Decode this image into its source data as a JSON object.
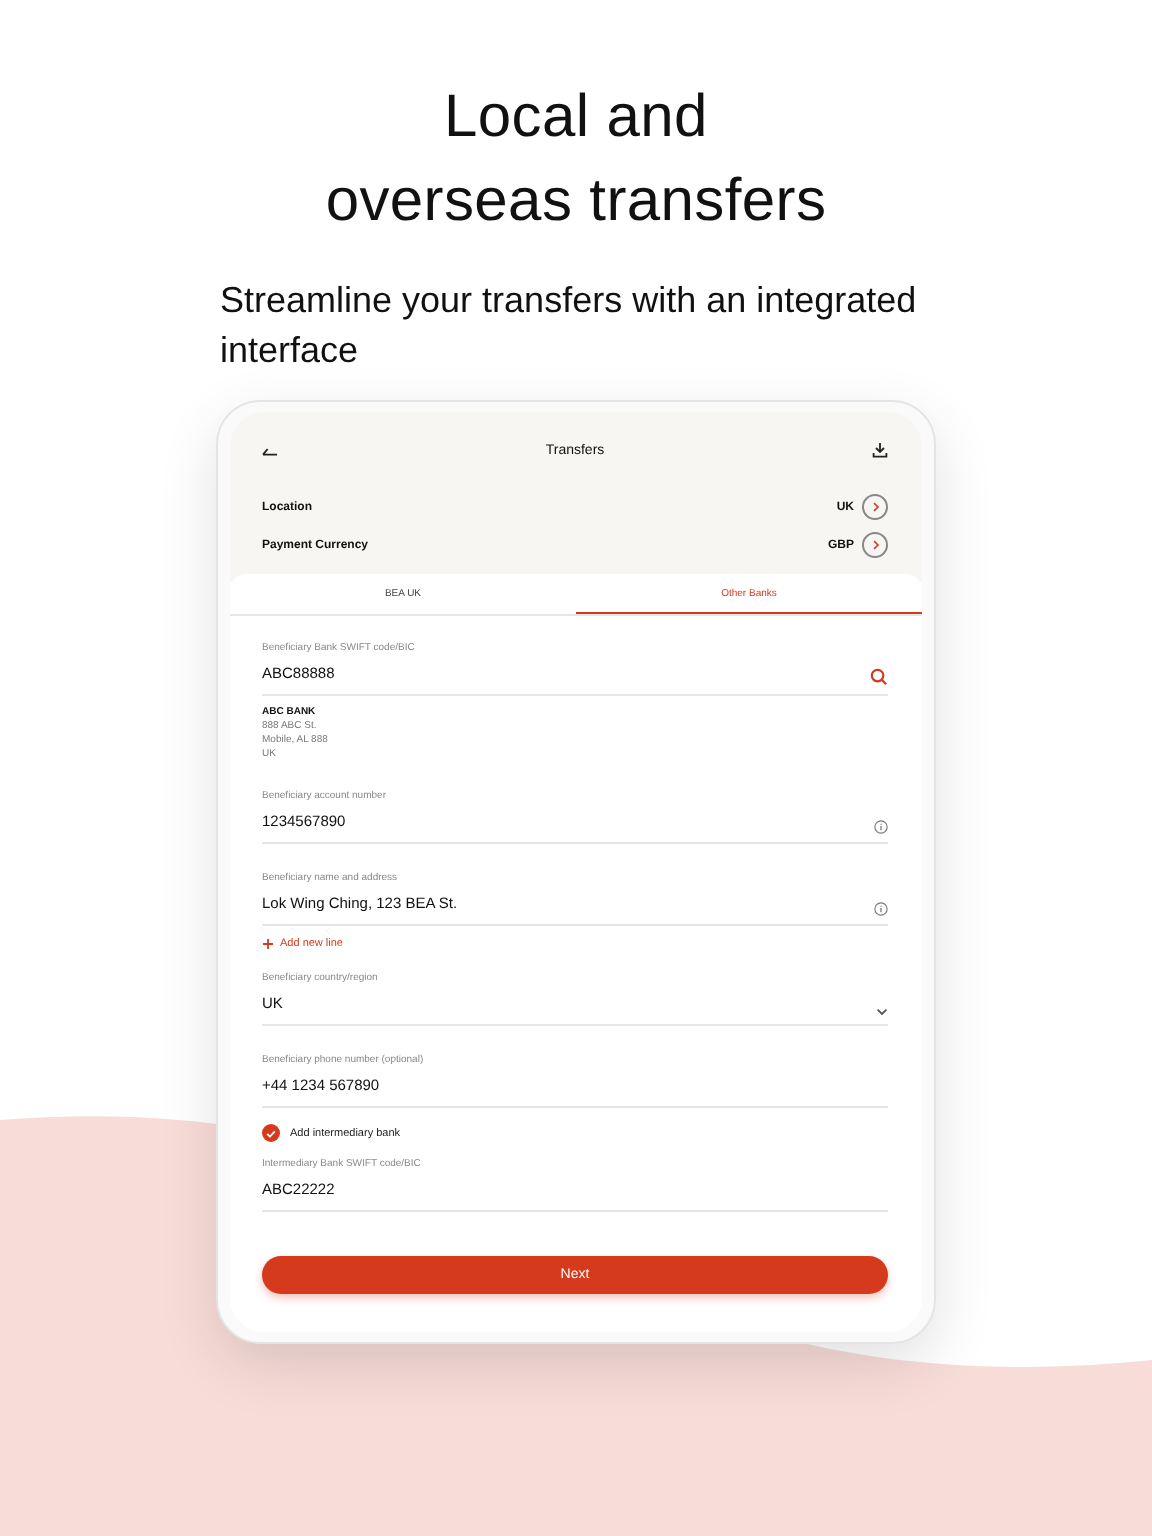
{
  "headline": [
    "Local and",
    "overseas transfers"
  ],
  "subtitle": "Streamline your transfers with an integrated interface",
  "screen": {
    "title": "Transfers",
    "settings": [
      {
        "label": "Location",
        "value": "UK"
      },
      {
        "label": "Payment Currency",
        "value": "GBP"
      }
    ],
    "tabs": [
      {
        "label": "BEA UK",
        "selected": false
      },
      {
        "label": "Other Banks",
        "selected": true
      }
    ],
    "form": [
      {
        "kind": "search",
        "label": "Beneficiary Bank SWIFT code/BIC",
        "value": "ABC88888"
      },
      {
        "kind": "address",
        "lines": [
          "ABC BANK",
          "888 ABC St.",
          "Mobile, AL 888",
          "UK"
        ]
      },
      {
        "kind": "info",
        "label": "Beneficiary account number",
        "value": "1234567890"
      },
      {
        "kind": "info",
        "label": "Beneficiary name and address",
        "value": "Lok Wing Ching, 123 BEA St."
      },
      {
        "kind": "add",
        "label": "Add new line"
      },
      {
        "kind": "select",
        "label": "Beneficiary country/region",
        "value": "UK"
      },
      {
        "kind": "text",
        "label": "Beneficiary phone number (optional)",
        "value": "+44 1234 567890"
      },
      {
        "kind": "checkbox",
        "label": "Add intermediary bank",
        "checked": true
      },
      {
        "kind": "text",
        "label": "Intermediary Bank SWIFT code/BIC",
        "value": "ABC22222"
      }
    ],
    "button": "Next"
  }
}
